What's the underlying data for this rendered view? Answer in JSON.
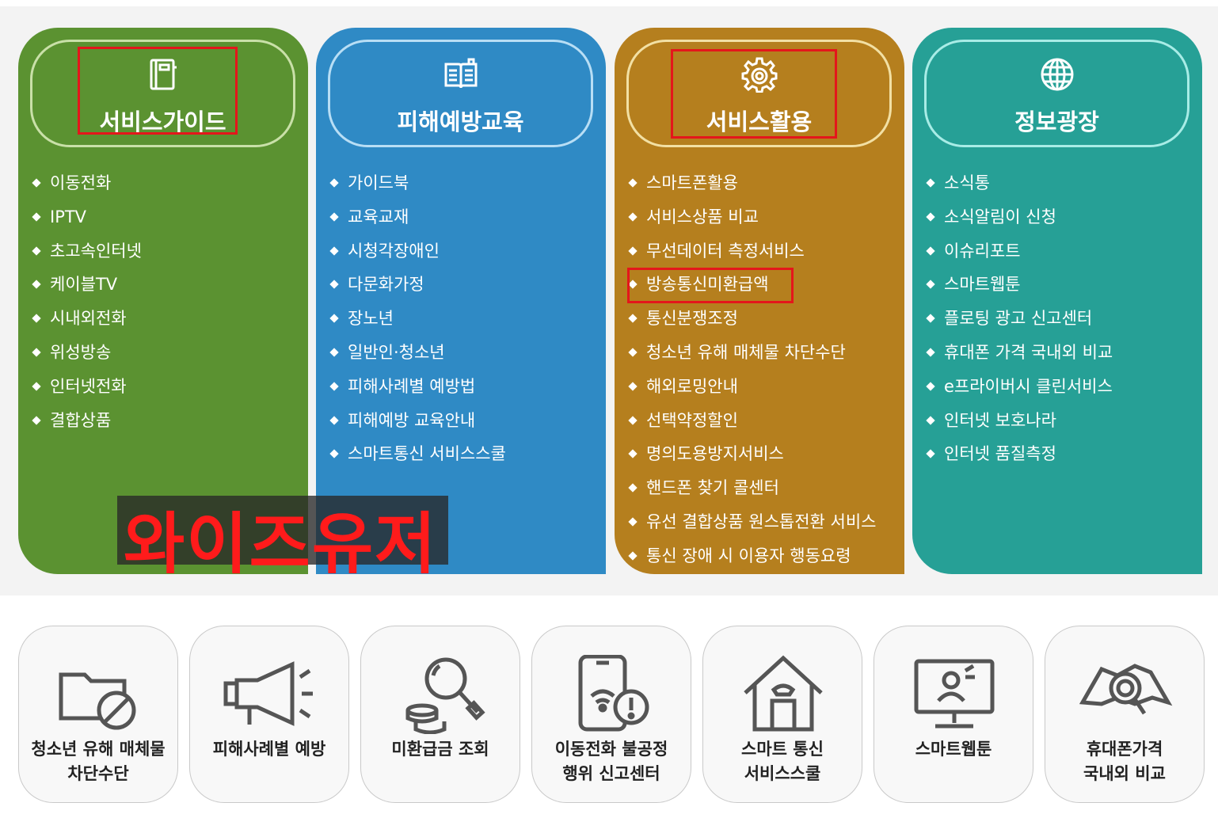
{
  "columns": [
    {
      "title": "서비스가이드",
      "icon": "notebook-icon",
      "color": "#5b9231",
      "items": [
        "이동전화",
        "IPTV",
        "초고속인터넷",
        "케이블TV",
        "시내외전화",
        "위성방송",
        "인터넷전화",
        "결합상품"
      ]
    },
    {
      "title": "피해예방교육",
      "icon": "book-icon",
      "color": "#2f8ac5",
      "items": [
        "가이드북",
        "교육교재",
        "시청각장애인",
        "다문화가정",
        "장노년",
        "일반인·청소년",
        "피해사례별 예방법",
        "피해예방 교육안내",
        "스마트통신 서비스스쿨"
      ]
    },
    {
      "title": "서비스활용",
      "icon": "gear-icon",
      "color": "#b57f1e",
      "items": [
        "스마트폰활용",
        "서비스상품 비교",
        "무선데이터 측정서비스",
        "방송통신미환급액",
        "통신분쟁조정",
        "청소년 유해 매체물 차단수단",
        "해외로밍안내",
        "선택약정할인",
        "명의도용방지서비스",
        "핸드폰 찾기 콜센터",
        "유선 결합상품 원스톱전환 서비스",
        "통신 장애 시 이용자 행동요령"
      ]
    },
    {
      "title": "정보광장",
      "icon": "globe-icon",
      "color": "#26a096",
      "items": [
        "소식통",
        "소식알림이 신청",
        "이슈리포트",
        "스마트웹툰",
        "플로팅 광고 신고센터",
        "휴대폰 가격 국내외 비교",
        "e프라이버시 클린서비스",
        "인터넷 보호나라",
        "인터넷 품질측정"
      ]
    }
  ],
  "watermark": "와이즈유저",
  "quick_links": [
    {
      "line1": "청소년 유해 매체물",
      "line2": "차단수단",
      "icon": "folder-block-icon"
    },
    {
      "line1": "피해사례별 예방",
      "line2": "",
      "icon": "megaphone-icon"
    },
    {
      "line1": "미환급금 조회",
      "line2": "",
      "icon": "magnifier-coins-icon"
    },
    {
      "line1": "이동전화 불공정",
      "line2": "행위 신고센터",
      "icon": "phone-alert-icon"
    },
    {
      "line1": "스마트 통신",
      "line2": "서비스스쿨",
      "icon": "house-phone-icon"
    },
    {
      "line1": "스마트웹툰",
      "line2": "",
      "icon": "monitor-icon"
    },
    {
      "line1": "휴대폰가격",
      "line2": "국내외 비교",
      "icon": "map-search-icon"
    }
  ]
}
